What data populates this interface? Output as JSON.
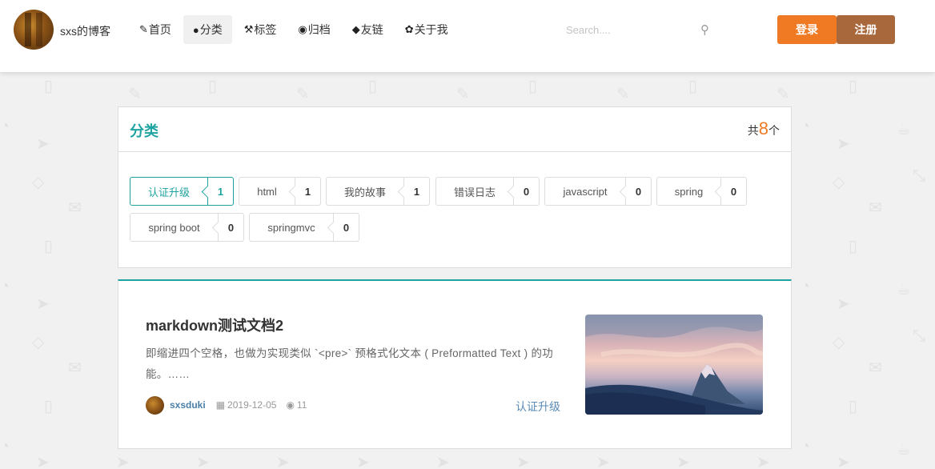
{
  "header": {
    "site_name": "sxs的博客",
    "nav": [
      {
        "icon": "pen-icon",
        "glyph": "✎",
        "label": "首页"
      },
      {
        "icon": "bulb-icon",
        "glyph": "●",
        "label": "分类"
      },
      {
        "icon": "wrench-icon",
        "glyph": "⚒",
        "label": "标签"
      },
      {
        "icon": "rss-icon",
        "glyph": "◉",
        "label": "归档"
      },
      {
        "icon": "fish-icon",
        "glyph": "◆",
        "label": "友链"
      },
      {
        "icon": "sprout-icon",
        "glyph": "✿",
        "label": "关于我"
      }
    ],
    "active_nav": "分类",
    "search": {
      "placeholder": "Search....",
      "value": ""
    },
    "login_label": "登录",
    "register_label": "注册",
    "colors": {
      "login": "#f07a23",
      "register": "#a8683b"
    }
  },
  "categories": {
    "title": "分类",
    "count_prefix": "共",
    "count": "8",
    "count_suffix": "个",
    "items": [
      {
        "name": "认证升级",
        "count": "1",
        "active": true
      },
      {
        "name": "html",
        "count": "1"
      },
      {
        "name": "我的故事",
        "count": "1"
      },
      {
        "name": "错误日志",
        "count": "0"
      },
      {
        "name": "javascript",
        "count": "0"
      },
      {
        "name": "spring",
        "count": "0"
      },
      {
        "name": "spring boot",
        "count": "0"
      },
      {
        "name": "springmvc",
        "count": "0"
      }
    ],
    "accent": "#1fa3a0"
  },
  "post": {
    "title": "markdown测试文档2",
    "excerpt": "即缩进四个空格，也做为实现类似 `<pre>` 预格式化文本 ( Preformatted Text ) 的功能。……",
    "author": "sxsduki",
    "date": "2019-12-05",
    "views": "11",
    "category": "认证升级"
  }
}
